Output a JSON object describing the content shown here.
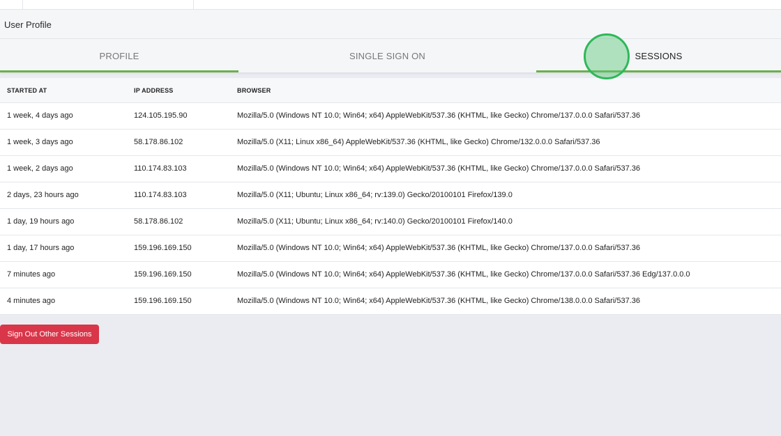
{
  "header": {
    "title": "User Profile"
  },
  "tabs": [
    {
      "label": "PROFILE"
    },
    {
      "label": "SINGLE SIGN ON"
    },
    {
      "label": "SESSIONS"
    }
  ],
  "table": {
    "columns": [
      "STARTED AT",
      "IP ADDRESS",
      "BROWSER"
    ],
    "rows": [
      {
        "started": "1 week, 4 days ago",
        "ip": "124.105.195.90",
        "browser": "Mozilla/5.0 (Windows NT 10.0; Win64; x64) AppleWebKit/537.36 (KHTML, like Gecko) Chrome/137.0.0.0 Safari/537.36"
      },
      {
        "started": "1 week, 3 days ago",
        "ip": "58.178.86.102",
        "browser": "Mozilla/5.0 (X11; Linux x86_64) AppleWebKit/537.36 (KHTML, like Gecko) Chrome/132.0.0.0 Safari/537.36"
      },
      {
        "started": "1 week, 2 days ago",
        "ip": "110.174.83.103",
        "browser": "Mozilla/5.0 (Windows NT 10.0; Win64; x64) AppleWebKit/537.36 (KHTML, like Gecko) Chrome/137.0.0.0 Safari/537.36"
      },
      {
        "started": "2 days, 23 hours ago",
        "ip": "110.174.83.103",
        "browser": "Mozilla/5.0 (X11; Ubuntu; Linux x86_64; rv:139.0) Gecko/20100101 Firefox/139.0"
      },
      {
        "started": "1 day, 19 hours ago",
        "ip": "58.178.86.102",
        "browser": "Mozilla/5.0 (X11; Ubuntu; Linux x86_64; rv:140.0) Gecko/20100101 Firefox/140.0"
      },
      {
        "started": "1 day, 17 hours ago",
        "ip": "159.196.169.150",
        "browser": "Mozilla/5.0 (Windows NT 10.0; Win64; x64) AppleWebKit/537.36 (KHTML, like Gecko) Chrome/137.0.0.0 Safari/537.36"
      },
      {
        "started": "7 minutes ago",
        "ip": "159.196.169.150",
        "browser": "Mozilla/5.0 (Windows NT 10.0; Win64; x64) AppleWebKit/537.36 (KHTML, like Gecko) Chrome/137.0.0.0 Safari/537.36 Edg/137.0.0.0"
      },
      {
        "started": "4 minutes ago",
        "ip": "159.196.169.150",
        "browser": "Mozilla/5.0 (Windows NT 10.0; Win64; x64) AppleWebKit/537.36 (KHTML, like Gecko) Chrome/138.0.0.0 Safari/537.36"
      }
    ]
  },
  "actions": {
    "sign_out_label": "Sign Out Other Sessions"
  },
  "colors": {
    "accent": "#6ab04c",
    "danger": "#d9364a"
  }
}
